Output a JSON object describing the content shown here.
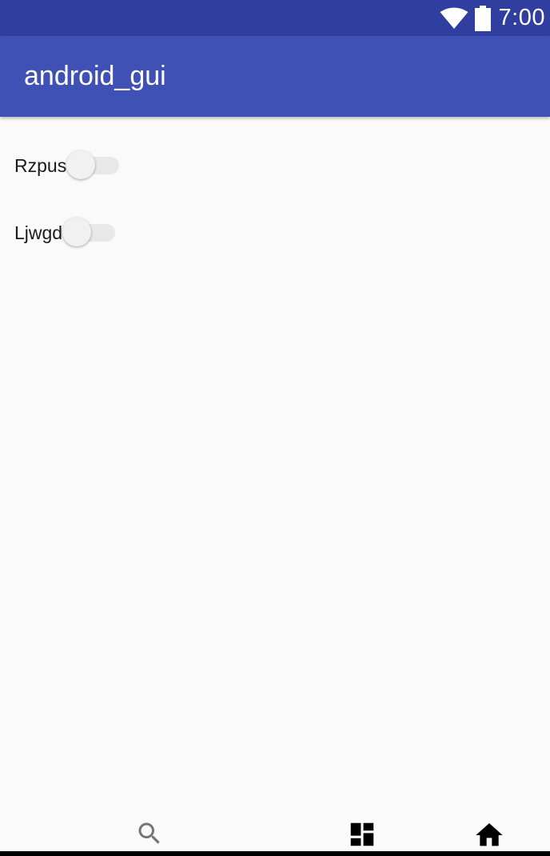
{
  "status_bar": {
    "time": "7:00",
    "icons": [
      "wifi-icon",
      "battery-icon"
    ],
    "background_color": "#303f9f"
  },
  "app_bar": {
    "title": "android_gui",
    "background_color": "#3f51b5"
  },
  "switches": [
    {
      "label": "Rzpus",
      "checked": false
    },
    {
      "label": "Ljwgd",
      "checked": false
    }
  ],
  "bottom_nav": {
    "items": [
      {
        "icon": "search-icon"
      },
      {
        "icon": "dashboard-icon"
      },
      {
        "icon": "home-icon"
      }
    ]
  }
}
